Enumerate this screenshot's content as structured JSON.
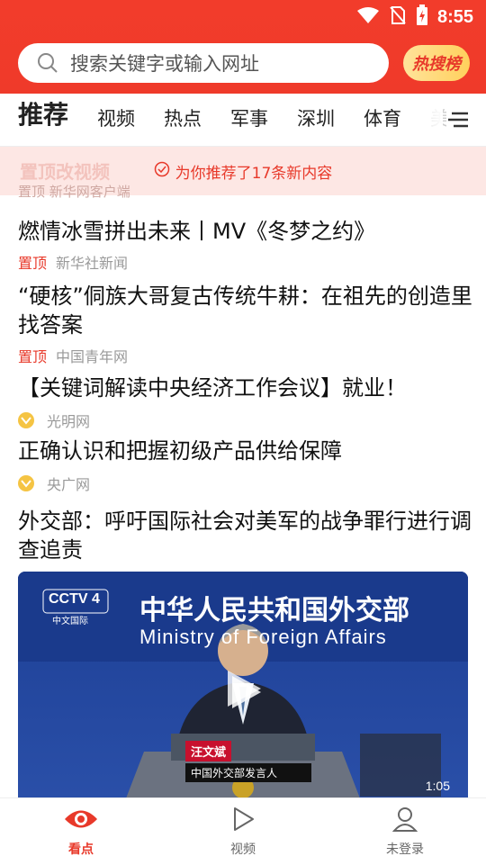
{
  "status": {
    "time": "8:55"
  },
  "search": {
    "placeholder": "搜索关键字或输入网址",
    "hot_label": "热搜榜"
  },
  "tabs": [
    "推荐",
    "视频",
    "热点",
    "军事",
    "深圳",
    "体育",
    "美"
  ],
  "toast": {
    "message": "为你推荐了17条新内容",
    "behind_text": "置顶改视频",
    "behind_meta": "置顶  新华网客户端"
  },
  "feed": [
    {
      "title": "燃情冰雪拼出未来丨MV《冬梦之约》",
      "pin": "置顶",
      "source": "新华社新闻"
    },
    {
      "title": "“硬核”侗族大哥复古传统牛耕：在祖先的创造里找答案",
      "pin": "置顶",
      "source": "中国青年网"
    },
    {
      "title": "【关键词解读中央经济工作会议】就业！",
      "source": "光明网"
    },
    {
      "title": "正确认识和把握初级产品供给保障",
      "source": "央广网"
    },
    {
      "title": "外交部：呼吁国际社会对美军的战争罪行进行调查追责"
    }
  ],
  "video": {
    "channel_logo": "CCTV 4",
    "channel_sub": "中文国际",
    "banner_cn": "中华人民共和国外交部",
    "banner_en": "Ministry of Foreign Affairs",
    "speaker_name": "汪文斌",
    "speaker_title": "中国外交部发言人",
    "duration": "1:05"
  },
  "nav": {
    "home": "看点",
    "video": "视频",
    "profile": "未登录"
  },
  "colors": {
    "brand": "#e8392a",
    "top_bar": "#f23c2b"
  }
}
